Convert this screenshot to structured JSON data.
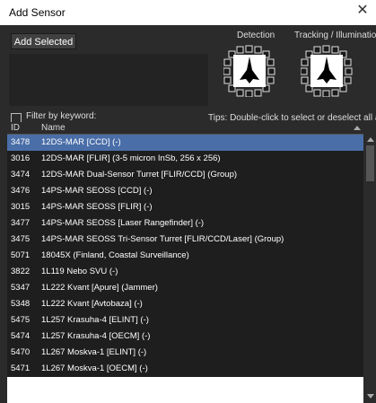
{
  "window": {
    "title": "Add Sensor",
    "close_symbol": "✕"
  },
  "toolbar": {
    "add_selected_label": "Add Selected"
  },
  "arcs": {
    "detection_label": "Detection",
    "tracking_label": "Tracking / Illuminatio"
  },
  "filter": {
    "label": "Filter by keyword:",
    "checked": false,
    "value": "",
    "placeholder": ""
  },
  "tips": "Tips: Double-click to select or deselect all a",
  "table": {
    "columns": {
      "id": "ID",
      "name": "Name"
    },
    "selected_id": "3478",
    "rows": [
      {
        "id": "3478",
        "name": "12DS-MAR [CCD] (-)"
      },
      {
        "id": "3016",
        "name": "12DS-MAR [FLIR] (3-5 micron InSb, 256 x 256)"
      },
      {
        "id": "3474",
        "name": "12DS-MAR Dual-Sensor Turret [FLIR/CCD] (Group)"
      },
      {
        "id": "3476",
        "name": "14PS-MAR SEOSS [CCD] (-)"
      },
      {
        "id": "3015",
        "name": "14PS-MAR SEOSS [FLIR] (-)"
      },
      {
        "id": "3477",
        "name": "14PS-MAR SEOSS [Laser Rangefinder] (-)"
      },
      {
        "id": "3475",
        "name": "14PS-MAR SEOSS Tri-Sensor Turret [FLIR/CCD/Laser] (Group)"
      },
      {
        "id": "5071",
        "name": "18045X (Finland, Coastal Surveillance)"
      },
      {
        "id": "3822",
        "name": "1L119 Nebo SVU (-)"
      },
      {
        "id": "5347",
        "name": "1L222 Kvant [Apure] (Jammer)"
      },
      {
        "id": "5348",
        "name": "1L222 Kvant [Avtobaza] (-)"
      },
      {
        "id": "5475",
        "name": "1L257 Krasuha-4 [ELINT] (-)"
      },
      {
        "id": "5474",
        "name": "1L257 Krasuha-4 [OECM] (-)"
      },
      {
        "id": "5470",
        "name": "1L267 Moskva-1 [ELINT] (-)"
      },
      {
        "id": "5471",
        "name": "1L267 Moskva-1 [OECM] (-)"
      }
    ]
  },
  "colors": {
    "background": "#2b2b2b",
    "selected_row": "#4a6ea8",
    "list_background": "#1e1e1e"
  }
}
